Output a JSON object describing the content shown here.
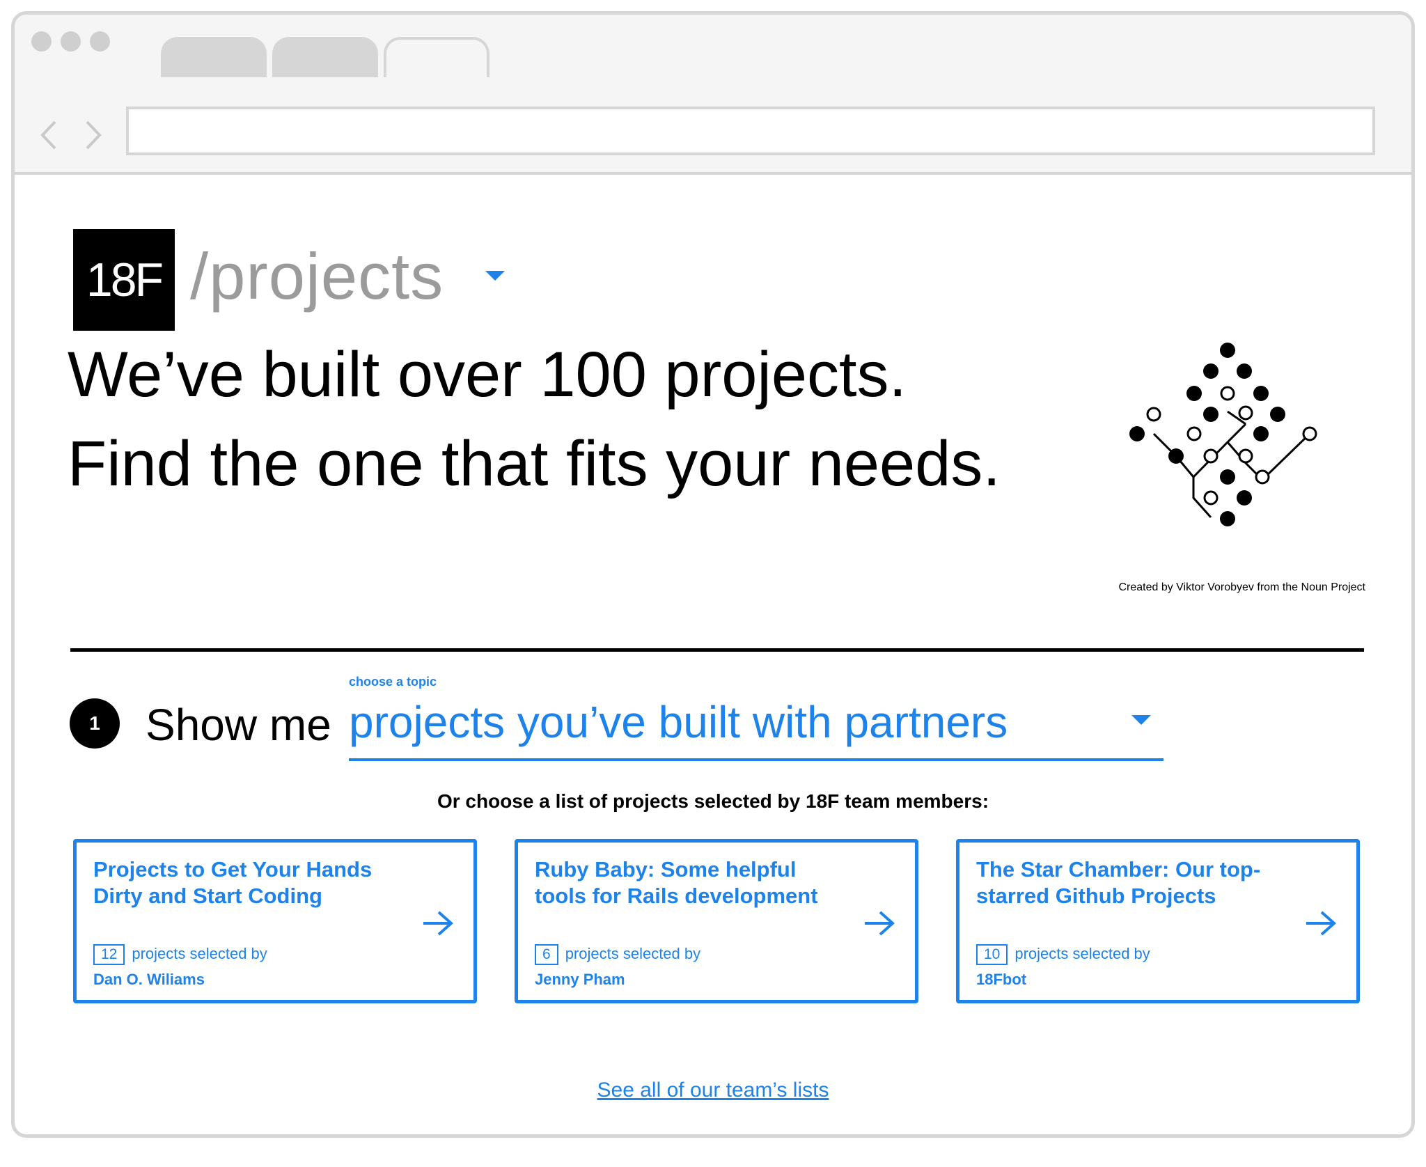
{
  "header": {
    "logo_text": "18F",
    "section_title": "/projects"
  },
  "hero": {
    "line1": "We’ve built over 100 projects.",
    "line2": "Find the one that fits your needs.",
    "image_credit": "Created by Viktor Vorobyev from the Noun Project"
  },
  "filter": {
    "step_number": "1",
    "prefix": "Show me",
    "topic_label": "choose a topic",
    "topic_value": "projects you’ve built with partners"
  },
  "lists": {
    "intro": "Or choose a list of projects selected by 18F team members:",
    "cards": [
      {
        "title": "Projects to Get Your Hands Dirty and Start Coding",
        "count": "12",
        "selected_by_label": "projects selected by",
        "author": "Dan O. Wiliams"
      },
      {
        "title": "Ruby Baby: Some helpful tools for Rails development",
        "count": "6",
        "selected_by_label": "projects selected by",
        "author": "Jenny Pham"
      },
      {
        "title": "The Star Chamber: Our top-starred Github Projects",
        "count": "10",
        "selected_by_label": "projects selected by",
        "author": "18Fbot"
      }
    ],
    "see_all_link": "See all of our team’s lists"
  },
  "colors": {
    "accent": "#1d83ea",
    "chrome": "#d6d6d6",
    "chrome_bg": "#f5f5f5"
  },
  "icons": {
    "graphic": "network-diamond-icon",
    "card_arrow": "arrow-right-icon",
    "dropdown": "caret-down-icon"
  }
}
